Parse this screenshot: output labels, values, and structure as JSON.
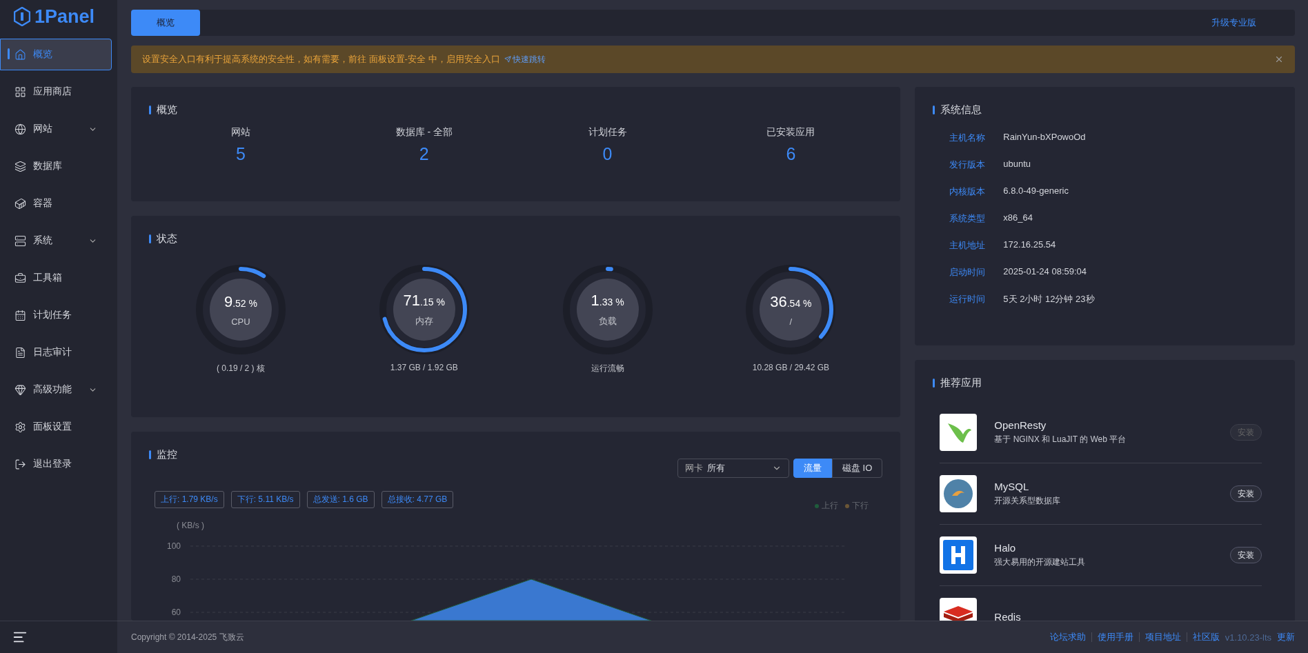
{
  "sidebar": {
    "logo": "1Panel",
    "items": [
      {
        "label": "概览",
        "selected": true,
        "has_submenu": false
      },
      {
        "label": "应用商店",
        "selected": false,
        "has_submenu": false
      },
      {
        "label": "网站",
        "selected": false,
        "has_submenu": true
      },
      {
        "label": "数据库",
        "selected": false,
        "has_submenu": false
      },
      {
        "label": "容器",
        "selected": false,
        "has_submenu": false
      },
      {
        "label": "系统",
        "selected": false,
        "has_submenu": true
      },
      {
        "label": "工具箱",
        "selected": false,
        "has_submenu": false
      },
      {
        "label": "计划任务",
        "selected": false,
        "has_submenu": false
      },
      {
        "label": "日志审计",
        "selected": false,
        "has_submenu": false
      },
      {
        "label": "高级功能",
        "selected": false,
        "has_submenu": true
      },
      {
        "label": "面板设置",
        "selected": false,
        "has_submenu": false
      },
      {
        "label": "退出登录",
        "selected": false,
        "has_submenu": false
      }
    ]
  },
  "top_bar": {
    "tabs": [
      {
        "label": "概览",
        "selected": true
      }
    ],
    "upgrade_link": "升级专业版"
  },
  "alert": {
    "message": "设置安全入口有利于提高系统的安全性，如有需要，前往 面板设置-安全 中，启用安全入口",
    "link": "快速跳转"
  },
  "overview": {
    "title": "概览",
    "stats": [
      {
        "label": "网站",
        "value": "5"
      },
      {
        "label": "数据库 - 全部",
        "value": "2"
      },
      {
        "label": "计划任务",
        "value": "0"
      },
      {
        "label": "已安装应用",
        "value": "6"
      }
    ]
  },
  "status": {
    "title": "状态",
    "gauges": [
      {
        "value": "9",
        "fraction": ".52 %",
        "label": "CPU",
        "level": 0.0952,
        "detail": "( 0.19 / 2 ) 核"
      },
      {
        "value": "71",
        "fraction": ".15 %",
        "label": "内存",
        "level": 0.7115,
        "detail": "1.37 GB / 1.92 GB"
      },
      {
        "value": "1",
        "fraction": ".33 %",
        "label": "负载",
        "level": 0.0133,
        "detail": "运行流畅"
      },
      {
        "value": "36",
        "fraction": ".54 %",
        "label": "/",
        "level": 0.3654,
        "detail": "10.28 GB / 29.42 GB"
      }
    ]
  },
  "monitor": {
    "title": "监控",
    "nic_select": {
      "label": "网卡",
      "value": "所有"
    },
    "modes": [
      {
        "label": "流量",
        "selected": true
      },
      {
        "label": "磁盘 IO",
        "selected": false
      }
    ],
    "tags": [
      "上行: 1.79 KB/s",
      "下行: 5.11 KB/s",
      "总发送: 1.6 GB",
      "总接收: 4.77 GB"
    ],
    "legend": [
      {
        "name": "上行",
        "color": "#1f5c3c"
      },
      {
        "name": "下行",
        "color": "#6b5636"
      }
    ],
    "chart": {
      "unit": "( KB/s )",
      "yticks": [
        "100",
        "80",
        "60"
      ]
    }
  },
  "system_info": {
    "title": "系统信息",
    "rows": [
      {
        "label": "主机名称",
        "value": "RainYun-bXPowoOd"
      },
      {
        "label": "发行版本",
        "value": "ubuntu"
      },
      {
        "label": "内核版本",
        "value": "6.8.0-49-generic"
      },
      {
        "label": "系统类型",
        "value": "x86_64"
      },
      {
        "label": "主机地址",
        "value": "172.16.25.54"
      },
      {
        "label": "启动时间",
        "value": "2025-01-24 08:59:04"
      },
      {
        "label": "运行时间",
        "value": "5天 2小时 12分钟 23秒"
      }
    ]
  },
  "recommended": {
    "title": "推荐应用",
    "apps": [
      {
        "name": "OpenResty",
        "description": "基于 NGINX 和 LuaJIT 的 Web 平台",
        "install": "安装",
        "disabled": true
      },
      {
        "name": "MySQL",
        "description": "开源关系型数据库",
        "install": "安装",
        "disabled": false
      },
      {
        "name": "Halo",
        "description": "强大易用的开源建站工具",
        "install": "安装",
        "disabled": false
      },
      {
        "name": "Redis"
      }
    ]
  },
  "footer": {
    "copyright": "Copyright © 2014-2025 飞致云",
    "links": [
      "论坛求助",
      "使用手册",
      "项目地址",
      "社区版"
    ],
    "version": "v1.10.23-lts",
    "update": "更新"
  }
}
